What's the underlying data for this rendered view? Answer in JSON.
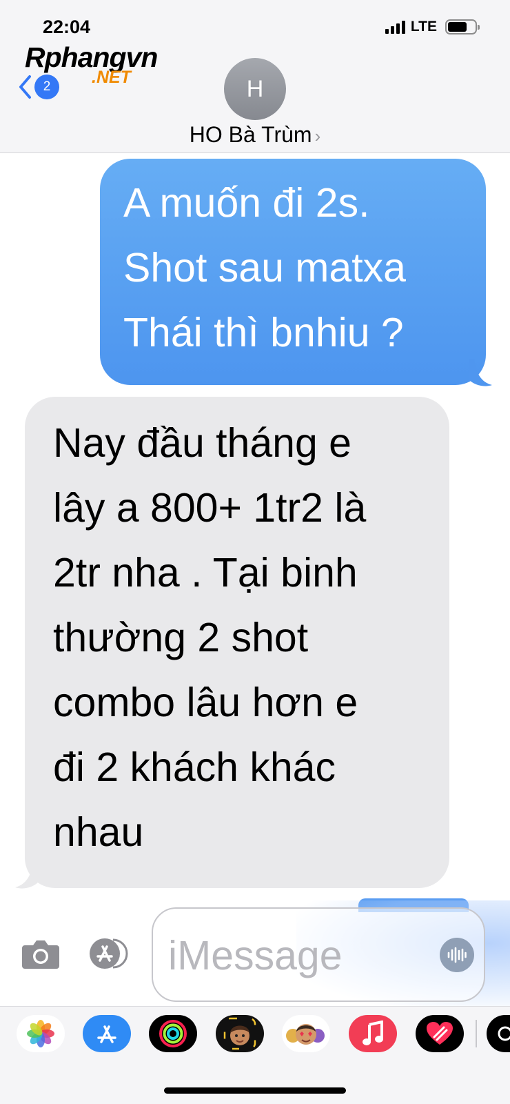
{
  "status_bar": {
    "time": "22:04",
    "network": "LTE",
    "battery_percent": 72
  },
  "watermark": {
    "brand": "Rphangvn",
    "suffix": ".NET"
  },
  "nav": {
    "unread_count": "2"
  },
  "contact": {
    "initial": "H",
    "name": "HO Bà Trùm",
    "chevron": "›"
  },
  "messages": [
    {
      "direction": "sent",
      "text": "A muốn đi 2s.\nShot sau matxa\nThái thì bnhiu ?"
    },
    {
      "direction": "received",
      "text": "Nay đầu tháng e\nlây a 800+ 1tr2 là\n2tr nha . Tại binh\nthường 2 shot\ncombo lâu hơn e\nđi 2 khách khác\nnhau"
    }
  ],
  "compose": {
    "placeholder": "iMessage"
  },
  "icons": {
    "camera": "camera-icon",
    "apps": "appstore-icon",
    "audio": "waveform-icon",
    "back": "chevron-left-icon"
  },
  "app_drawer": [
    "photos",
    "app-store",
    "fitness",
    "memoji",
    "memoji-stickers",
    "music",
    "digital-touch",
    "more"
  ],
  "colors": {
    "sent_bubble": "#5aa0f2",
    "received_bubble": "#e9e9eb",
    "accent": "#3478f6",
    "brand_red": "#d2232a",
    "brand_orange": "#f08a00"
  }
}
